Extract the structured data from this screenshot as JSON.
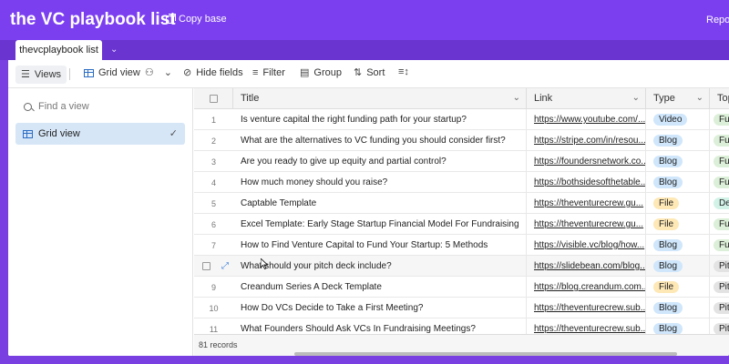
{
  "header": {
    "base_title": "the VC playbook list",
    "copy_base": "Copy base",
    "report": "Repor"
  },
  "tabs": {
    "active": "thevcplaybook list"
  },
  "toolbar": {
    "views": "Views",
    "grid_view": "Grid view",
    "hide_fields": "Hide fields",
    "filter": "Filter",
    "group": "Group",
    "sort": "Sort"
  },
  "sidebar": {
    "find_placeholder": "Find a view",
    "items": [
      {
        "label": "Grid view"
      }
    ]
  },
  "grid": {
    "columns": [
      "Title",
      "Link",
      "Type",
      "Topi"
    ],
    "rows": [
      {
        "num": "1",
        "title": "Is venture capital the right funding path for your startup?",
        "link": "https://www.youtube.com/...",
        "type": "Video",
        "topic": "Fun"
      },
      {
        "num": "2",
        "title": "What are the alternatives to VC funding you should consider first?",
        "link": "https://stripe.com/in/resou...",
        "type": "Blog",
        "topic": "Fun"
      },
      {
        "num": "3",
        "title": "Are you ready to give up equity and partial control?",
        "link": "https://foundersnetwork.co...",
        "type": "Blog",
        "topic": "Fun"
      },
      {
        "num": "4",
        "title": "How much money should you raise?",
        "link": "https://bothsidesofthetable...",
        "type": "Blog",
        "topic": "Fun"
      },
      {
        "num": "5",
        "title": "Captable Template",
        "link": "https://theventurecrew.gu...",
        "type": "File",
        "topic": "Dea"
      },
      {
        "num": "6",
        "title": "Excel Template: Early Stage Startup Financial Model For Fundraising",
        "link": "https://theventurecrew.gu...",
        "type": "File",
        "topic": "Fun"
      },
      {
        "num": "7",
        "title": "How to Find Venture Capital to Fund Your Startup: 5 Methods",
        "link": "https://visible.vc/blog/how...",
        "type": "Blog",
        "topic": "Fun"
      },
      {
        "num": "",
        "title": "What should your pitch deck include?",
        "link": "https://slidebean.com/blog...",
        "type": "Blog",
        "topic": "Pitc"
      },
      {
        "num": "9",
        "title": "Creandum Series A Deck Template",
        "link": "https://blog.creandum.com...",
        "type": "File",
        "topic": "Pitc"
      },
      {
        "num": "10",
        "title": "How Do VCs Decide to Take a First Meeting?",
        "link": "https://theventurecrew.sub...",
        "type": "Blog",
        "topic": "Pitc"
      },
      {
        "num": "11",
        "title": "What Founders Should Ask VCs In Fundraising Meetings?",
        "link": "https://theventurecrew.sub...",
        "type": "Blog",
        "topic": "Pitc"
      }
    ],
    "records": "81 records"
  }
}
